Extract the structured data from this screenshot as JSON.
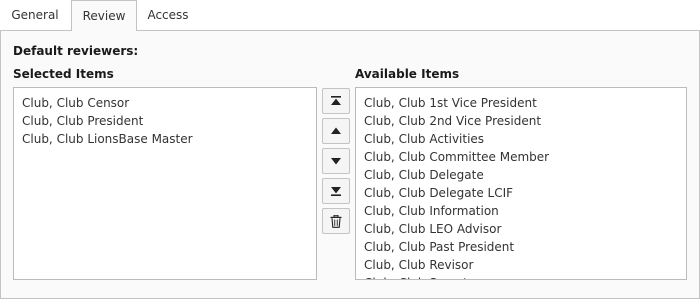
{
  "tabs": [
    {
      "label": "General",
      "active": false
    },
    {
      "label": "Review",
      "active": true
    },
    {
      "label": "Access",
      "active": false
    }
  ],
  "section": {
    "heading": "Default reviewers:"
  },
  "selected": {
    "label": "Selected Items",
    "items": [
      "Club, Club Censor",
      "Club, Club President",
      "Club, Club LionsBase Master"
    ]
  },
  "available": {
    "label": "Available Items",
    "items": [
      "Club, Club 1st Vice President",
      "Club, Club 2nd Vice President",
      "Club, Club Activities",
      "Club, Club Committee Member",
      "Club, Club Delegate",
      "Club, Club Delegate LCIF",
      "Club, Club Information",
      "Club, Club LEO Advisor",
      "Club, Club Past President",
      "Club, Club Revisor",
      "Club, Club Secretary"
    ]
  },
  "buttons": [
    {
      "icon": "move-to-top-icon"
    },
    {
      "icon": "move-up-icon"
    },
    {
      "icon": "move-down-icon"
    },
    {
      "icon": "move-to-bottom-icon"
    },
    {
      "icon": "trash-icon"
    }
  ]
}
